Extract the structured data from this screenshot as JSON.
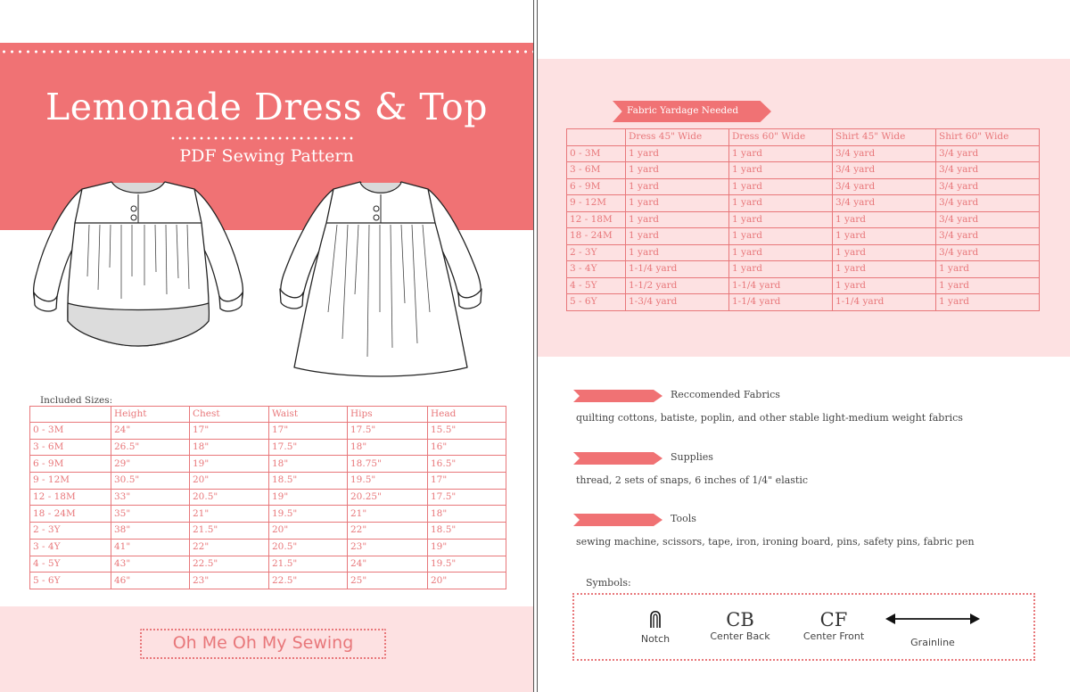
{
  "left": {
    "title": "Lemonade Dress & Top",
    "subtitle": "PDF Sewing Pattern",
    "sizes_label": "Included Sizes:",
    "sizes_headers": [
      "",
      "Height",
      "Chest",
      "Waist",
      "Hips",
      "Head"
    ],
    "sizes_rows": [
      [
        "0 - 3M",
        "24\"",
        "17\"",
        "17\"",
        "17.5\"",
        "15.5\""
      ],
      [
        "3 - 6M",
        "26.5\"",
        "18\"",
        "17.5\"",
        "18\"",
        "16\""
      ],
      [
        "6 - 9M",
        "29\"",
        "19\"",
        "18\"",
        "18.75\"",
        "16.5\""
      ],
      [
        "9 - 12M",
        "30.5\"",
        "20\"",
        "18.5\"",
        "19.5\"",
        "17\""
      ],
      [
        "12 - 18M",
        "33\"",
        "20.5\"",
        "19\"",
        "20.25\"",
        "17.5\""
      ],
      [
        "18 - 24M",
        "35\"",
        "21\"",
        "19.5\"",
        "21\"",
        "18\""
      ],
      [
        "2 - 3Y",
        "38\"",
        "21.5\"",
        "20\"",
        "22\"",
        "18.5\""
      ],
      [
        "3 - 4Y",
        "41\"",
        "22\"",
        "20.5\"",
        "23\"",
        "19\""
      ],
      [
        "4 - 5Y",
        "43\"",
        "22.5\"",
        "21.5\"",
        "24\"",
        "19.5\""
      ],
      [
        "5 - 6Y",
        "46\"",
        "23\"",
        "22.5\"",
        "25\"",
        "20\""
      ]
    ],
    "footer_brand": "Oh Me Oh My Sewing"
  },
  "right": {
    "yardage_tag": "Fabric Yardage Needed",
    "yardage_headers": [
      "",
      "Dress 45\" Wide",
      "Dress 60\" Wide",
      "Shirt 45\" Wide",
      "Shirt 60\" Wide"
    ],
    "yardage_rows": [
      [
        "0 - 3M",
        "1 yard",
        "1 yard",
        "3/4 yard",
        "3/4 yard"
      ],
      [
        "3 - 6M",
        "1 yard",
        "1 yard",
        "3/4 yard",
        "3/4 yard"
      ],
      [
        "6 - 9M",
        "1 yard",
        "1 yard",
        "3/4 yard",
        "3/4 yard"
      ],
      [
        "9 - 12M",
        "1 yard",
        "1 yard",
        "3/4 yard",
        "3/4 yard"
      ],
      [
        "12 - 18M",
        "1 yard",
        "1 yard",
        "1 yard",
        "3/4 yard"
      ],
      [
        "18 - 24M",
        "1 yard",
        "1 yard",
        "1 yard",
        "3/4 yard"
      ],
      [
        "2 - 3Y",
        "1 yard",
        "1 yard",
        "1 yard",
        "3/4 yard"
      ],
      [
        "3 - 4Y",
        "1-1/4 yard",
        "1 yard",
        "1 yard",
        "1 yard"
      ],
      [
        "4 - 5Y",
        "1-1/2 yard",
        "1-1/4 yard",
        "1 yard",
        "1 yard"
      ],
      [
        "5 - 6Y",
        "1-3/4 yard",
        "1-1/4 yard",
        "1-1/4 yard",
        "1 yard"
      ]
    ],
    "fabrics_title": "Reccomended Fabrics",
    "fabrics_body": "quilting cottons, batiste, poplin, and other stable light-medium weight fabrics",
    "supplies_title": "Supplies",
    "supplies_body": "thread, 2 sets of snaps, 6 inches of 1/4\" elastic",
    "tools_title": "Tools",
    "tools_body": "sewing machine, scissors, tape, iron, ironing board, pins, safety pins, fabric pen",
    "symbols_label": "Symbols:",
    "symbols": {
      "notch_label": "Notch",
      "cb_symbol": "CB",
      "cb_label": "Center Back",
      "cf_symbol": "CF",
      "cf_label": "Center Front",
      "grainline_label": "Grainline"
    }
  },
  "colors": {
    "accent": "#f07274",
    "light_pink": "#fde1e2",
    "table_line": "#e8777a"
  }
}
